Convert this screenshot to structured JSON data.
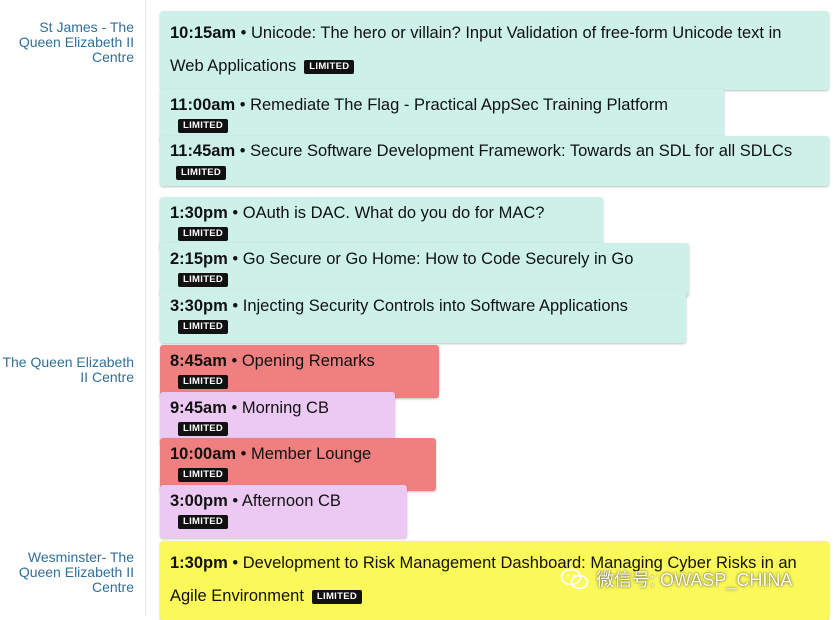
{
  "venues": [
    {
      "name": "St James - The Queen Elizabeth II Centre"
    },
    {
      "name": "The Queen Elizabeth II Centre"
    },
    {
      "name": "Wesminster- The Queen Elizabeth II Centre"
    }
  ],
  "badge_label": "LIMITED",
  "sessions": [
    {
      "time": "10:15am",
      "sep": " • ",
      "title": "Unicode: The hero or villain? Input Validation of free-form Unicode text in Web Applications",
      "color": "#cdf1e9"
    },
    {
      "time": "11:00am",
      "sep": " • ",
      "title": "Remediate The Flag - Practical AppSec Training Platform",
      "color": "#cdf1e9"
    },
    {
      "time": "11:45am",
      "sep": " • ",
      "title": "Secure Software Development Framework: Towards an SDL for all SDLCs",
      "color": "#cdf1e9"
    },
    {
      "time": "1:30pm",
      "sep": " • ",
      "title": "OAuth is DAC. What do you do for MAC?",
      "color": "#cdf1e9"
    },
    {
      "time": "2:15pm",
      "sep": " • ",
      "title": "Go Secure or Go Home: How to Code Securely in Go",
      "color": "#cdf1e9"
    },
    {
      "time": "3:30pm",
      "sep": " • ",
      "title": "Injecting Security Controls into Software Applications",
      "color": "#cdf1e9"
    },
    {
      "time": "8:45am",
      "sep": " • ",
      "title": "Opening Remarks",
      "color": "#f08080"
    },
    {
      "time": "9:45am",
      "sep": " • ",
      "title": "Morning CB",
      "color": "#ebc9f3"
    },
    {
      "time": "10:00am",
      "sep": " • ",
      "title": "Member Lounge",
      "color": "#f08080"
    },
    {
      "time": "3:00pm",
      "sep": " • ",
      "title": "Afternoon CB",
      "color": "#ebc9f3"
    },
    {
      "time": "1:30pm",
      "sep": " • ",
      "title": "Development to Risk Management Dashboard: Managing Cyber Risks in an Agile Environment",
      "color": "#fbf959"
    }
  ],
  "watermark": {
    "text": "微信号: OWASP_CHINA",
    "icon": "wechat-icon"
  }
}
